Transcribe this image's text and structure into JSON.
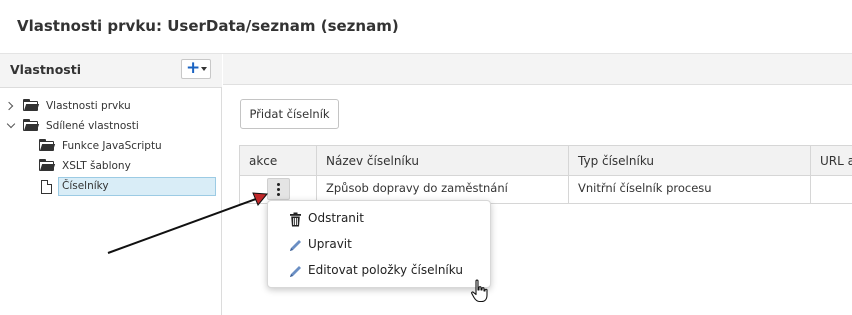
{
  "dialog": {
    "title": "Vlastnosti prvku: UserData/seznam (seznam)"
  },
  "left_panel": {
    "title": "Vlastnosti",
    "add_button": {
      "symbol": "+",
      "icon": "caret-down-icon"
    },
    "tree": [
      {
        "label": "Vlastnosti prvku",
        "icon": "folder-icon",
        "expander": "chevron-right-icon"
      },
      {
        "label": "Sdílené vlastnosti",
        "icon": "folder-icon",
        "expander": "chevron-down-icon"
      },
      {
        "label": "Funkce JavaScriptu",
        "icon": "folder-icon"
      },
      {
        "label": "XSLT šablony",
        "icon": "folder-icon"
      },
      {
        "label": "Číselníky",
        "icon": "document-icon",
        "selected": true
      }
    ]
  },
  "main": {
    "add_button_label": "Přidat číselník",
    "table": {
      "columns": [
        "akce",
        "Název číselníku",
        "Typ číselníku",
        "URL a"
      ],
      "rows": [
        {
          "name": "Způsob dopravy do zaměstnání",
          "type": "Vnitřní číselník procesu",
          "url": ""
        }
      ]
    },
    "row_actions_icon": "kebab-menu-icon"
  },
  "context_menu": {
    "items": [
      {
        "label": "Odstranit",
        "icon": "trash-icon"
      },
      {
        "label": "Upravit",
        "icon": "pencil-icon"
      },
      {
        "label": "Editovat položky číselníku",
        "icon": "pencil-icon"
      }
    ]
  },
  "colors": {
    "accent": "#1a63c2",
    "selected_bg": "#d9edf7",
    "header_bg": "#f4f4f4",
    "pencil": "#6b8fc4"
  }
}
